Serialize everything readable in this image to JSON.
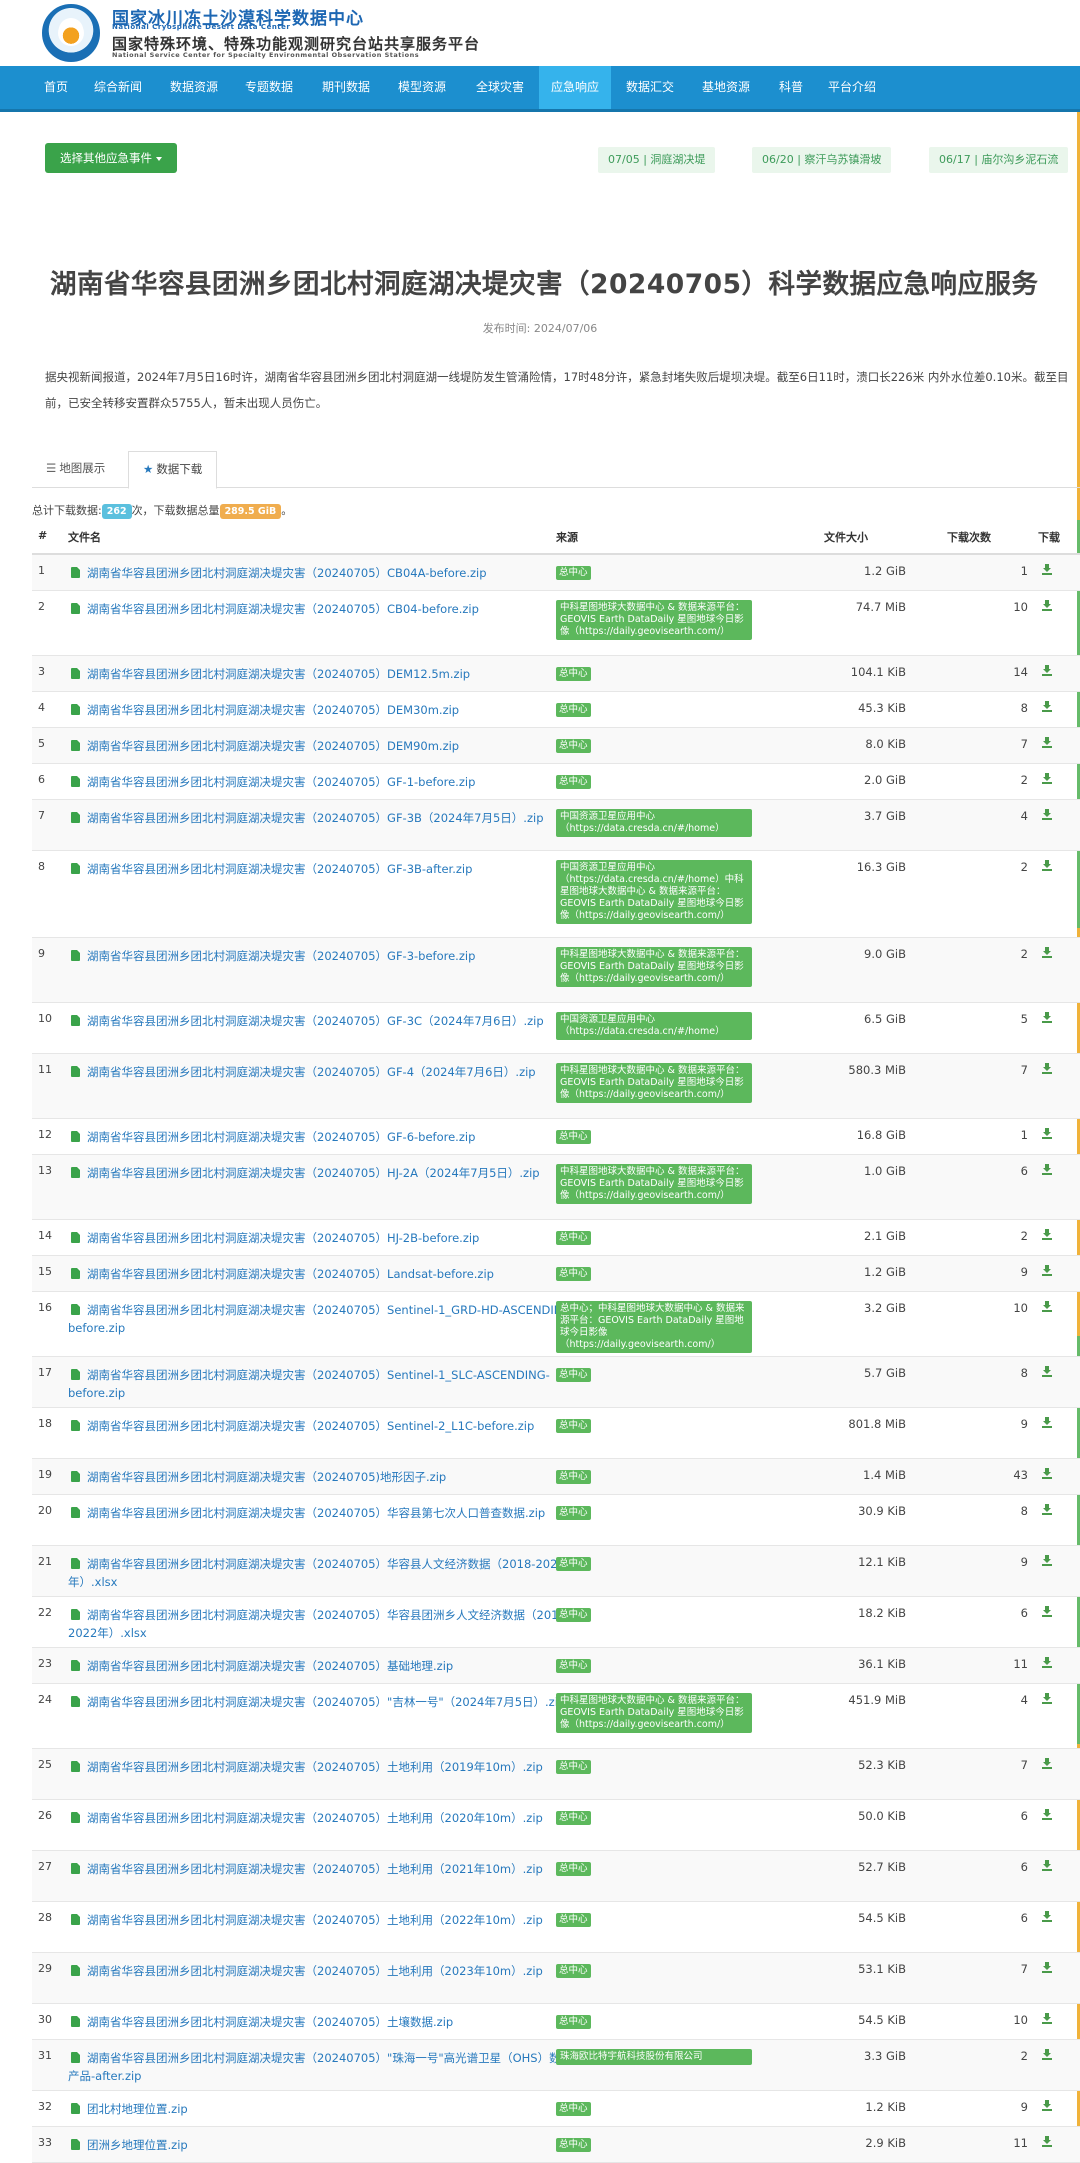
{
  "header": {
    "title_cn": "国家冰川冻土沙漠科学数据中心",
    "title_en": "National Cryosphere Desert Data Center",
    "subtitle_cn": "国家特殊环境、特殊功能观测研究台站共享服务平台",
    "subtitle_en": "National Service Center for Specialty Environmental Observation Stations"
  },
  "nav": {
    "items": [
      "首页",
      "综合新闻",
      "数据资源",
      "专题数据",
      "期刊数据",
      "模型资源",
      "全球灾害",
      "应急响应",
      "数据汇交",
      "基地资源",
      "科普",
      "平台介绍"
    ],
    "active": "应急响应"
  },
  "event_select": {
    "label": "选择其他应急事件",
    "events": [
      "07/05 | 洞庭湖决堤",
      "06/20 | 察汗乌苏镇滑坡",
      "06/17 | 庙尔沟乡泥石流"
    ]
  },
  "article": {
    "title": "湖南省华容县团洲乡团北村洞庭湖决堤灾害（20240705）科学数据应急响应服务",
    "publish": "发布时间:  2024/07/06",
    "summary": "据央视新闻报道，2024年7月5日16时许，湖南省华容县团洲乡团北村洞庭湖一线堤防发生管涌险情，17时48分许，紧急封堵失败后堤坝决堤。截至6日11时，溃口长226米 内外水位差0.10米。截至目前，已安全转移安置群众5755人，暂未出现人员伤亡。"
  },
  "tabs": {
    "map": "地图展示",
    "download": "数据下载",
    "active": "数据下载"
  },
  "stats": {
    "prefix": "总计下载数据:",
    "count": "262",
    "mid": "次，下载数据总量",
    "total": "289.5 GiB",
    "suffix": "。"
  },
  "table": {
    "headers": {
      "idx": "#",
      "name": "文件名",
      "source": "来源",
      "size": "文件大小",
      "count": "下载次数",
      "download": "下载"
    },
    "rows": [
      {
        "idx": "1",
        "name": "湖南省华容县团洲乡团北村洞庭湖决堤灾害（20240705）CB04A-before.zip",
        "source": "总中心",
        "size": "1.2 GiB",
        "count": "1",
        "h": 35
      },
      {
        "idx": "2",
        "name": "湖南省华容县团洲乡团北村洞庭湖决堤灾害（20240705）CB04-before.zip",
        "source": "中科星图地球大数据中心 & 数据来源平台：GEOVIS Earth DataDaily 星图地球今日影像（https://daily.geovisearth.com/）",
        "size": "74.7 MiB",
        "count": "10",
        "h": 64
      },
      {
        "idx": "3",
        "name": "湖南省华容县团洲乡团北村洞庭湖决堤灾害（20240705）DEM12.5m.zip",
        "source": "总中心",
        "size": "104.1 KiB",
        "count": "14",
        "h": 35
      },
      {
        "idx": "4",
        "name": "湖南省华容县团洲乡团北村洞庭湖决堤灾害（20240705）DEM30m.zip",
        "source": "总中心",
        "size": "45.3 KiB",
        "count": "8",
        "h": 35
      },
      {
        "idx": "5",
        "name": "湖南省华容县团洲乡团北村洞庭湖决堤灾害（20240705）DEM90m.zip",
        "source": "总中心",
        "size": "8.0 KiB",
        "count": "7",
        "h": 35
      },
      {
        "idx": "6",
        "name": "湖南省华容县团洲乡团北村洞庭湖决堤灾害（20240705）GF-1-before.zip",
        "source": "总中心",
        "size": "2.0 GiB",
        "count": "2",
        "h": 35
      },
      {
        "idx": "7",
        "name": "湖南省华容县团洲乡团北村洞庭湖决堤灾害（20240705）GF-3B（2024年7月5日）.zip",
        "source": "中国资源卫星应用中心（https://data.cresda.cn/#/home）",
        "size": "3.7 GiB",
        "count": "4",
        "h": 50
      },
      {
        "idx": "8",
        "name": "湖南省华容县团洲乡团北村洞庭湖决堤灾害（20240705）GF-3B-after.zip",
        "source": "中国资源卫星应用中心（https://data.cresda.cn/#/home）中科星图地球大数据中心 & 数据来源平台：GEOVIS Earth DataDaily 星图地球今日影像（https://daily.geovisearth.com/）",
        "size": "16.3 GiB",
        "count": "2",
        "h": 86
      },
      {
        "idx": "9",
        "name": "湖南省华容县团洲乡团北村洞庭湖决堤灾害（20240705）GF-3-before.zip",
        "source": "中科星图地球大数据中心 & 数据来源平台：GEOVIS Earth DataDaily 星图地球今日影像（https://daily.geovisearth.com/）",
        "size": "9.0 GiB",
        "count": "2",
        "h": 64
      },
      {
        "idx": "10",
        "name": "湖南省华容县团洲乡团北村洞庭湖决堤灾害（20240705）GF-3C（2024年7月6日）.zip",
        "source": "中国资源卫星应用中心（https://data.cresda.cn/#/home）",
        "size": "6.5 GiB",
        "count": "5",
        "h": 50
      },
      {
        "idx": "11",
        "name": "湖南省华容县团洲乡团北村洞庭湖决堤灾害（20240705）GF-4（2024年7月6日）.zip",
        "source": "中科星图地球大数据中心 & 数据来源平台：GEOVIS Earth DataDaily 星图地球今日影像（https://daily.geovisearth.com/）",
        "size": "580.3 MiB",
        "count": "7",
        "h": 64
      },
      {
        "idx": "12",
        "name": "湖南省华容县团洲乡团北村洞庭湖决堤灾害（20240705）GF-6-before.zip",
        "source": "总中心",
        "size": "16.8 GiB",
        "count": "1",
        "h": 35
      },
      {
        "idx": "13",
        "name": "湖南省华容县团洲乡团北村洞庭湖决堤灾害（20240705）HJ-2A（2024年7月5日）.zip",
        "source": "中科星图地球大数据中心 & 数据来源平台：GEOVIS Earth DataDaily 星图地球今日影像（https://daily.geovisearth.com/）",
        "size": "1.0 GiB",
        "count": "6",
        "h": 64
      },
      {
        "idx": "14",
        "name": "湖南省华容县团洲乡团北村洞庭湖决堤灾害（20240705）HJ-2B-before.zip",
        "source": "总中心",
        "size": "2.1 GiB",
        "count": "2",
        "h": 35
      },
      {
        "idx": "15",
        "name": "湖南省华容县团洲乡团北村洞庭湖决堤灾害（20240705）Landsat-before.zip",
        "source": "总中心",
        "size": "1.2 GiB",
        "count": "9",
        "h": 35
      },
      {
        "idx": "16",
        "name": "湖南省华容县团洲乡团北村洞庭湖决堤灾害（20240705）Sentinel-1_GRD-HD-ASCENDING-before.zip",
        "source": "总中心；中科星图地球大数据中心 & 数据来源平台：GEOVIS Earth DataDaily 星图地球今日影像（https://daily.geovisearth.com/）",
        "size": "3.2 GiB",
        "count": "10",
        "h": 64
      },
      {
        "idx": "17",
        "name": "湖南省华容县团洲乡团北村洞庭湖决堤灾害（20240705）Sentinel-1_SLC-ASCENDING-before.zip",
        "source": "总中心",
        "size": "5.7 GiB",
        "count": "8",
        "h": 50
      },
      {
        "idx": "18",
        "name": "湖南省华容县团洲乡团北村洞庭湖决堤灾害（20240705）Sentinel-2_L1C-before.zip",
        "source": "总中心",
        "size": "801.8 MiB",
        "count": "9",
        "h": 50
      },
      {
        "idx": "19",
        "name": "湖南省华容县团洲乡团北村洞庭湖决堤灾害（20240705)地形因子.zip",
        "source": "总中心",
        "size": "1.4 MiB",
        "count": "43",
        "h": 35
      },
      {
        "idx": "20",
        "name": "湖南省华容县团洲乡团北村洞庭湖决堤灾害（20240705）华容县第七次人口普查数据.zip",
        "source": "总中心",
        "size": "30.9 KiB",
        "count": "8",
        "h": 50
      },
      {
        "idx": "21",
        "name": "湖南省华容县团洲乡团北村洞庭湖决堤灾害（20240705）华容县人文经济数据（2018-2022年）.xlsx",
        "source": "总中心",
        "size": "12.1 KiB",
        "count": "9",
        "h": 50
      },
      {
        "idx": "22",
        "name": "湖南省华容县团洲乡团北村洞庭湖决堤灾害（20240705）华容县团洲乡人文经济数据（2018-2022年）.xlsx",
        "source": "总中心",
        "size": "18.2 KiB",
        "count": "6",
        "h": 50
      },
      {
        "idx": "23",
        "name": "湖南省华容县团洲乡团北村洞庭湖决堤灾害（20240705）基础地理.zip",
        "source": "总中心",
        "size": "36.1 KiB",
        "count": "11",
        "h": 35
      },
      {
        "idx": "24",
        "name": "湖南省华容县团洲乡团北村洞庭湖决堤灾害（20240705）\"吉林一号\"（2024年7月5日）.zip",
        "source": "中科星图地球大数据中心 & 数据来源平台：GEOVIS Earth DataDaily 星图地球今日影像（https://daily.geovisearth.com/）",
        "size": "451.9 MiB",
        "count": "4",
        "h": 64
      },
      {
        "idx": "25",
        "name": "湖南省华容县团洲乡团北村洞庭湖决堤灾害（20240705）土地利用（2019年10m）.zip",
        "source": "总中心",
        "size": "52.3 KiB",
        "count": "7",
        "h": 50
      },
      {
        "idx": "26",
        "name": "湖南省华容县团洲乡团北村洞庭湖决堤灾害（20240705）土地利用（2020年10m）.zip",
        "source": "总中心",
        "size": "50.0 KiB",
        "count": "6",
        "h": 50
      },
      {
        "idx": "27",
        "name": "湖南省华容县团洲乡团北村洞庭湖决堤灾害（20240705）土地利用（2021年10m）.zip",
        "source": "总中心",
        "size": "52.7 KiB",
        "count": "6",
        "h": 50
      },
      {
        "idx": "28",
        "name": "湖南省华容县团洲乡团北村洞庭湖决堤灾害（20240705）土地利用（2022年10m）.zip",
        "source": "总中心",
        "size": "54.5 KiB",
        "count": "6",
        "h": 50
      },
      {
        "idx": "29",
        "name": "湖南省华容县团洲乡团北村洞庭湖决堤灾害（20240705）土地利用（2023年10m）.zip",
        "source": "总中心",
        "size": "53.1 KiB",
        "count": "7",
        "h": 50
      },
      {
        "idx": "30",
        "name": "湖南省华容县团洲乡团北村洞庭湖决堤灾害（20240705）土壤数据.zip",
        "source": "总中心",
        "size": "54.5 KiB",
        "count": "10",
        "h": 35
      },
      {
        "idx": "31",
        "name": "湖南省华容县团洲乡团北村洞庭湖决堤灾害（20240705）\"珠海一号\"高光谱卫星（OHS）数据产品-after.zip",
        "source": "珠海欧比特宇航科技股份有限公司",
        "size": "3.3 GiB",
        "count": "2",
        "h": 50
      },
      {
        "idx": "32",
        "name": "团北村地理位置.zip",
        "source": "总中心",
        "size": "1.2 KiB",
        "count": "9",
        "h": 35
      },
      {
        "idx": "33",
        "name": "团洲乡地理位置.zip",
        "source": "总中心",
        "size": "2.9 KiB",
        "count": "11",
        "h": 35
      }
    ]
  }
}
